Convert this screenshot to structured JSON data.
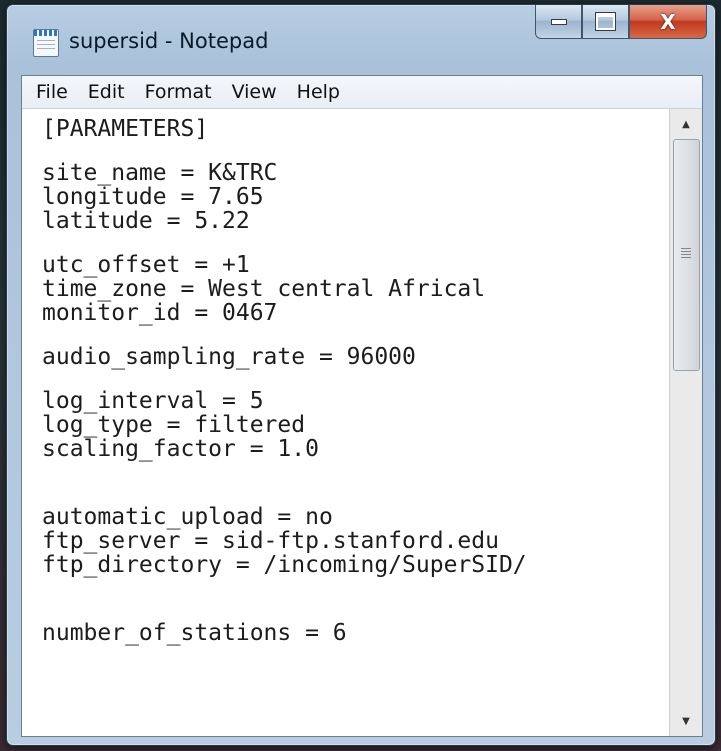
{
  "window": {
    "title": "supersid - Notepad",
    "close_glyph": "X",
    "icons": {
      "app": "notepad-icon",
      "minimize": "minimize-icon",
      "maximize": "maximize-icon",
      "close": "close-icon"
    }
  },
  "menu": [
    "File",
    "Edit",
    "Format",
    "View",
    "Help"
  ],
  "content": {
    "header": "[PARAMETERS]",
    "site_name": "site_name = K&TRC",
    "longitude": "longitude = 7.65",
    "latitude": "latitude = 5.22",
    "utc_offset": "utc_offset = +1",
    "time_zone": "time_zone = West central Africal",
    "monitor_id": "monitor_id = 0467",
    "audio_sampling_rate": "audio_sampling_rate = 96000",
    "log_interval": "log_interval = 5",
    "log_type": "log_type = filtered",
    "scaling_factor": "scaling_factor = 1.0",
    "automatic_upload": "automatic_upload = no",
    "ftp_server": "ftp_server = sid-ftp.stanford.edu",
    "ftp_directory": "ftp_directory = /incoming/SuperSID/",
    "number_of_stations": "number_of_stations = 6"
  },
  "scrollbar": {
    "up_glyph": "▲",
    "down_glyph": "▼",
    "position": 0.0
  }
}
